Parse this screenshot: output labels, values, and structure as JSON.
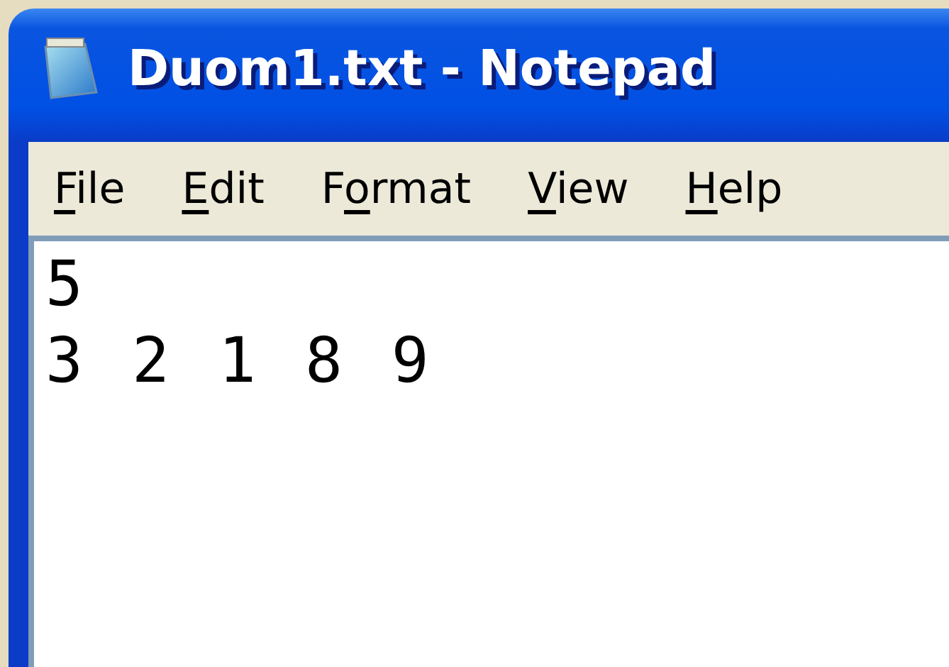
{
  "window": {
    "title": "Duom1.txt - Notepad"
  },
  "menu": [
    {
      "key": "F",
      "rest": "ile"
    },
    {
      "key": "E",
      "rest": "dit"
    },
    {
      "pre": "F",
      "key": "o",
      "rest": "rmat"
    },
    {
      "key": "V",
      "rest": "iew"
    },
    {
      "key": "H",
      "rest": "elp"
    }
  ],
  "editor": {
    "lines": [
      "5",
      "3 2 1 8 9"
    ]
  }
}
